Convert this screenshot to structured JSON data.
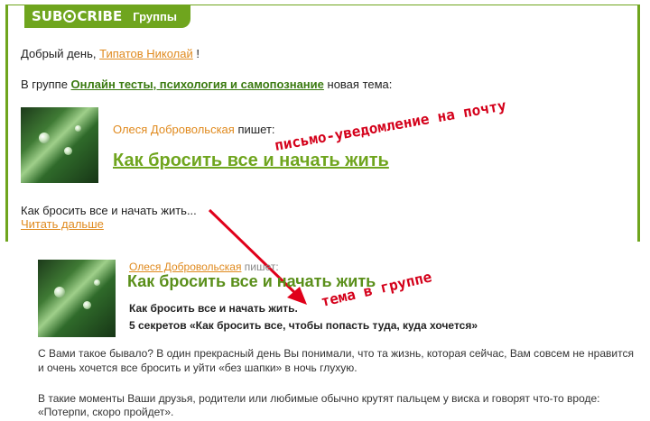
{
  "email": {
    "logo": "SUBSCRIBE",
    "tab_label": "Группы",
    "greeting_prefix": "Добрый день,",
    "user_name": "Типатов Николай",
    "greeting_suffix": "!",
    "group_prefix": "В группе",
    "group_name": "Онлайн тесты, психология и самопознание",
    "group_suffix": "новая тема:",
    "author": "Олеся Добровольская",
    "writes": "пишет:",
    "topic_title": "Как бросить все и начать жить",
    "excerpt": "Как бросить все и начать жить...",
    "read_more": "Читать дальше"
  },
  "group_post": {
    "author": "Олеся Добровольская",
    "writes": "пишет:",
    "title": "Как бросить все и начать жить",
    "subtitle": "Как бросить все и начать жить.",
    "secrets_line": "5 секретов «Как бросить все, чтобы попасть туда, куда хочется»",
    "para1_line1": "С Вами такое бывало? В один прекрасный день Вы понимали, что та жизнь, которая сейчас, Вам совсем не нравится",
    "para1_line2": "и очень хочется все бросить и уйти «без шапки» в ночь глухую.",
    "para2_line1": "В такие моменты Ваши друзья, родители или любимые обычно крутят пальцем у виска и говорят что-то вроде:",
    "para2_line2": "«Потерпи, скоро пройдет»."
  },
  "annotations": {
    "email_note": "письмо-уведомление на почту",
    "group_note": "тема в группе",
    "color": "#d4001a"
  },
  "colors": {
    "brand_green": "#6fa51e",
    "link_orange": "#e08a1e"
  }
}
